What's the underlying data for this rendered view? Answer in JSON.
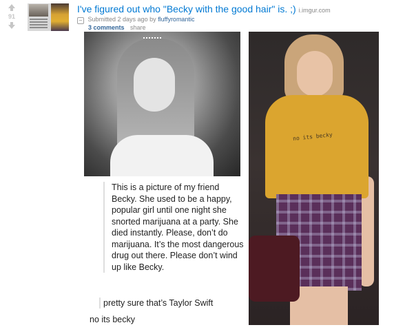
{
  "post": {
    "score": "91",
    "title": "I've figured out who \"Becky with the good hair\" is. ;)",
    "domain": "i.imgur.com",
    "expando_symbol": "–",
    "submitted_prefix": "Submitted 2 days ago by",
    "author": "fluffyromantic",
    "comments_label": "3 comments",
    "share_label": "share"
  },
  "image": {
    "quote_text": "This is a picture of my friend Becky. She used to be a happy, popular girl until one night she snorted marijuana at a party. She died instantly. Please, don’t do marijuana. It’s the most dangerous drug out there. Please don’t wind up like Becky.",
    "reply_1": "pretty sure that’s Taylor Swift",
    "reply_2": "no its becky",
    "shirt_text": "no its becky"
  },
  "colors": {
    "link": "#0079d3",
    "meta": "#888888",
    "vote_arrow": "#c6c6c6"
  }
}
